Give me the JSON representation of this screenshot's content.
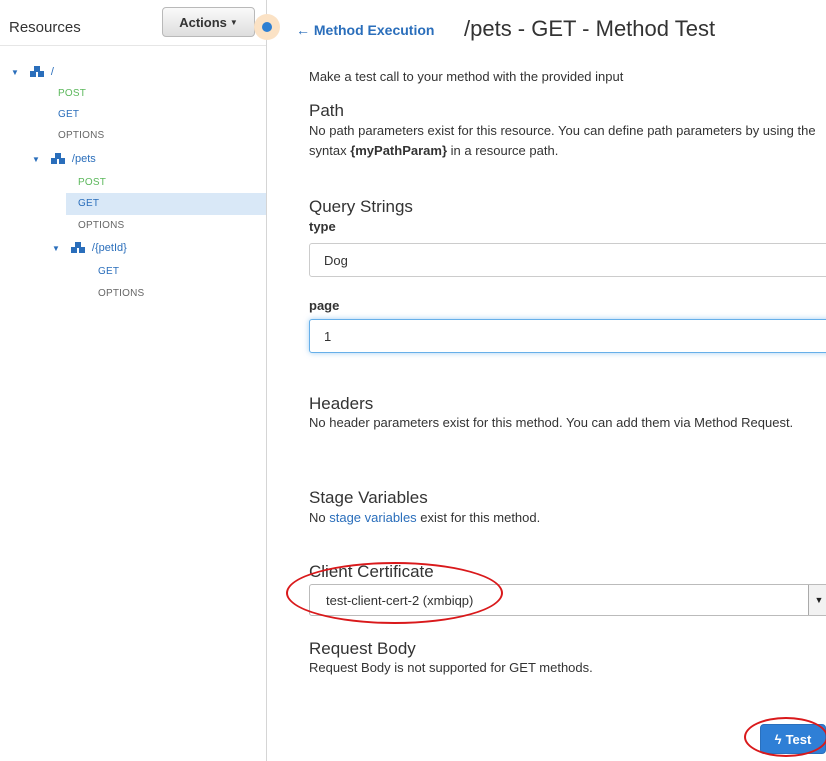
{
  "sidebar": {
    "title": "Resources",
    "actions_label": "Actions",
    "tree": [
      {
        "kind": "resource",
        "label": "/"
      },
      {
        "kind": "method",
        "label": "POST"
      },
      {
        "kind": "method",
        "label": "GET"
      },
      {
        "kind": "method",
        "label": "OPTIONS"
      },
      {
        "kind": "resource",
        "label": "/pets"
      },
      {
        "kind": "method",
        "label": "POST"
      },
      {
        "kind": "method",
        "label": "GET",
        "selected": true
      },
      {
        "kind": "method",
        "label": "OPTIONS"
      },
      {
        "kind": "resource",
        "label": "/{petId}"
      },
      {
        "kind": "method",
        "label": "GET"
      },
      {
        "kind": "method",
        "label": "OPTIONS"
      }
    ]
  },
  "header": {
    "back_link": "Method Execution",
    "title": "/pets - GET - Method Test"
  },
  "main": {
    "intro": "Make a test call to your method with the provided input",
    "path": {
      "heading": "Path",
      "text_before": "No path parameters exist for this resource. You can define path parameters by using the syntax ",
      "syntax": "{myPathParam}",
      "text_after": " in a resource path."
    },
    "query": {
      "heading": "Query Strings",
      "type_label": "type",
      "type_value": "Dog",
      "page_label": "page",
      "page_value": "1"
    },
    "headers": {
      "heading": "Headers",
      "text": "No header parameters exist for this method. You can add them via Method Request."
    },
    "stage": {
      "heading": "Stage Variables",
      "text_before": "No ",
      "link": "stage variables",
      "text_after": " exist for this method."
    },
    "cert": {
      "heading": "Client Certificate",
      "selected": "test-client-cert-2 (xmbiqp)"
    },
    "body": {
      "heading": "Request Body",
      "text": "Request Body is not supported for GET methods."
    },
    "test_button": "Test"
  },
  "colors": {
    "accent": "#2a6ebb",
    "post": "#5cb85c",
    "annotation": "#d9191b",
    "button": "#2f7fd6"
  }
}
